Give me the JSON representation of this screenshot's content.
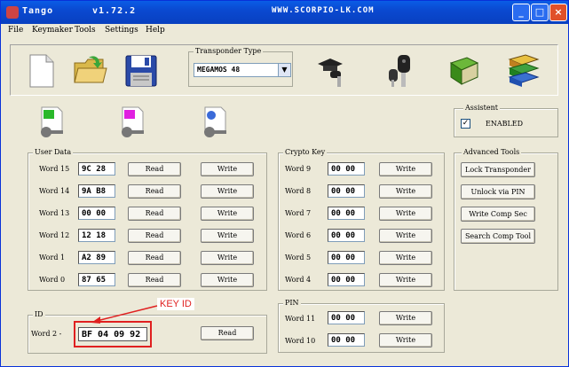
{
  "window": {
    "app_name": "Tango",
    "version": "v1.72.2",
    "url": "WWW.SCORPIO-LK.COM"
  },
  "menu": [
    "File",
    "Keymaker",
    "Tools",
    "Settings",
    "Help"
  ],
  "transponder": {
    "label": "Transponder Type",
    "selected": "MEGAMOS 48"
  },
  "assistant": {
    "title": "Assistent",
    "checkbox_label": "ENABLED",
    "checked": true
  },
  "user_data": {
    "title": "User Data",
    "read_label": "Read",
    "write_label": "Write",
    "rows": [
      {
        "label": "Word 15",
        "value": "9C 28"
      },
      {
        "label": "Word 14",
        "value": "9A B8"
      },
      {
        "label": "Word 13",
        "value": "00 00"
      },
      {
        "label": "Word 12",
        "value": "12 18"
      },
      {
        "label": "Word  1",
        "value": "A2 89"
      },
      {
        "label": "Word  0",
        "value": "87 65"
      }
    ]
  },
  "crypto_key": {
    "title": "Crypto Key",
    "write_label": "Write",
    "rows": [
      {
        "label": "Word  9",
        "value": "00 00"
      },
      {
        "label": "Word  8",
        "value": "00 00"
      },
      {
        "label": "Word  7",
        "value": "00 00"
      },
      {
        "label": "Word  6",
        "value": "00 00"
      },
      {
        "label": "Word  5",
        "value": "00 00"
      },
      {
        "label": "Word  4",
        "value": "00 00"
      }
    ]
  },
  "advanced_tools": {
    "title": "Advanced Tools",
    "buttons": [
      "Lock Transponder",
      "Unlock via PIN",
      "Write Comp Sec",
      "Search Comp Tool"
    ]
  },
  "id_group": {
    "title": "ID",
    "label": "Word  2 -",
    "value": "BF 04 09 92",
    "read_label": "Read"
  },
  "pin": {
    "title": "PIN",
    "write_label": "Write",
    "rows": [
      {
        "label": "Word 11",
        "value": "00 00"
      },
      {
        "label": "Word 10",
        "value": "00 00"
      }
    ]
  },
  "annotation": {
    "text": "KEY ID",
    "color": "#e02020"
  }
}
